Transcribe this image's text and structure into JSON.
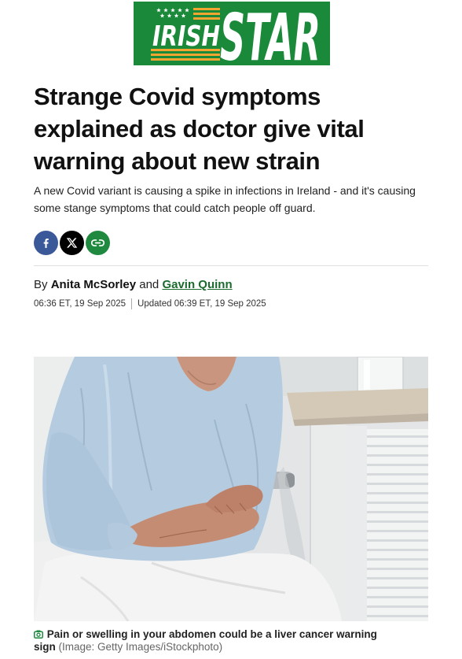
{
  "logo": {
    "word_irish": "IRISH",
    "word_star": "STAR",
    "icon": "stars-and-stripes-icon",
    "bg_color": "#1a8a3a",
    "stripe_color": "#f2a531"
  },
  "article": {
    "headline": "Strange Covid symptoms explained as doctor give vital warning about new strain",
    "standfirst": "A new Covid variant is causing a spike in infections in Ireland - and it's causing some stange symptoms that could catch people off guard.",
    "share": {
      "facebook": {
        "icon": "facebook-icon",
        "color": "#3b5998"
      },
      "x": {
        "icon": "x-icon",
        "color": "#000000"
      },
      "copy_link": {
        "icon": "link-icon",
        "color": "#1f8a3f"
      }
    },
    "byline": {
      "prefix": "By",
      "author_1": "Anita McSorley",
      "joiner": "and",
      "author_2": "Gavin Quinn",
      "author_2_color": "#1b6b2e"
    },
    "dates": {
      "published": "06:36 ET, 19 Sep 2025",
      "updated": "Updated 06:39 ET, 19 Sep 2025"
    },
    "image": {
      "caption_icon": "camera-icon",
      "caption": "Pain or swelling in your abdomen could be a liver cancer warning sign",
      "credit": "(Image: Getty Images/iStockphoto)"
    }
  }
}
